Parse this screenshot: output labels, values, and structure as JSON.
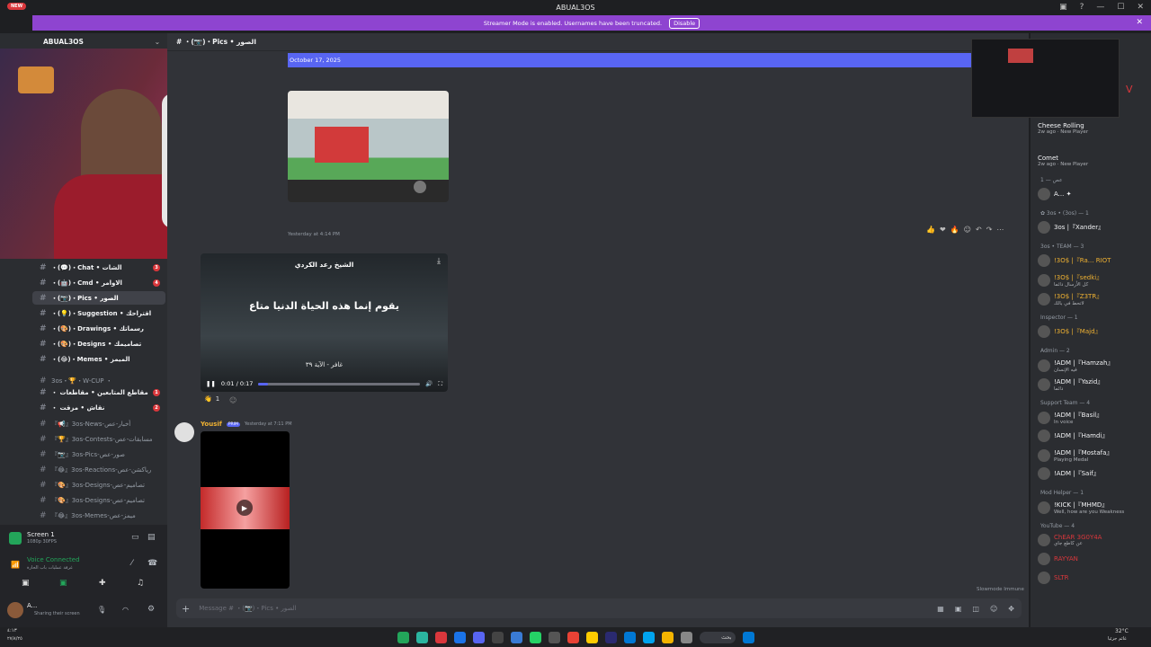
{
  "window": {
    "title": "ABUAL3OS",
    "new_badge": "NEW"
  },
  "banner": {
    "text": "Streamer Mode is enabled. Usernames have been truncated.",
    "button": "Disable"
  },
  "server": {
    "name": "ABUAL3OS"
  },
  "channel_header": {
    "name": "# ・(📷)・Pics • الصور"
  },
  "channels": [
    {
      "label": "・(💬)・Chat • الشات",
      "badge": "3",
      "white": true
    },
    {
      "label": "・(🤖)・Cmd • الاوامر",
      "badge": "4",
      "white": true
    },
    {
      "label": "・(📷)・Pics • الصور",
      "badge": "",
      "white": true,
      "selected": true
    },
    {
      "label": "・(💡)・Suggestion • اقتراحك",
      "badge": "",
      "white": true
    },
    {
      "label": "・(🎨)・Drawings • رسماتك",
      "badge": "",
      "white": true
    },
    {
      "label": "・(🎨)・Designs • تصاميمك",
      "badge": "",
      "white": true
    },
    {
      "label": "・(😂)・Memes • الميمز",
      "badge": "",
      "white": true
    },
    {
      "label": "3os・🏆・W-CUP ・",
      "badge": "",
      "white": false
    },
    {
      "label": "・ مقاطع المتابعين • مقاطعات",
      "badge": "1",
      "white": true
    },
    {
      "label": "・ نقاش • مزقت",
      "badge": "2",
      "white": true
    },
    {
      "label": "『📢』3os-News-أخبار-عص",
      "badge": "",
      "white": false
    },
    {
      "label": "『🏆』3os-Contests-مسابقات-عص",
      "badge": "",
      "white": false
    },
    {
      "label": "『📷』3os-Pics-صور-عص",
      "badge": "",
      "white": false
    },
    {
      "label": "『😂』3os-Reactions-رياكشن-عص",
      "badge": "",
      "white": false
    },
    {
      "label": "『🎨』3os-Designs-تصاميم-عص",
      "badge": "",
      "white": false
    },
    {
      "label": "『🎨』3os-Designs-تصاميم-عص",
      "badge": "",
      "white": false
    },
    {
      "label": "『😂』3os-Memes-ميمز-عص",
      "badge": "",
      "white": false
    }
  ],
  "voice": {
    "screen_label": "Screen 1",
    "screen_sub": "1080p 30FPS",
    "connected": "Voice Connected",
    "connected_sub": "غرفة عمليات باب الحارة",
    "user": "A...",
    "user_status": "Sharing their screen"
  },
  "chat": {
    "date": "October 17, 2025",
    "timestamp1": "Yesterday at 4:14 PM",
    "video_title": "الشيخ رعد الكردي",
    "video_text": "يقوم إنما هذه الحياة الدنيا متاع",
    "video_caption": "غافر - الآية ٣٩",
    "video_time": "0:01 / 0:17",
    "video_progress": 0.06,
    "reaction_count": "1",
    "msg2_author": "Yousif",
    "msg2_tag": "PRIM",
    "msg2_time": "Yesterday at 7:11 PM",
    "input_placeholder": "Message # ・(📷)・Pics • الصور",
    "slowmode": "Slowmode Immune"
  },
  "members": {
    "activities": [
      {
        "name": "Cheese Rolling",
        "sub": "2w ago · New Player"
      },
      {
        "name": "Comet",
        "sub": "2w ago · New Player"
      }
    ],
    "groups": [
      {
        "label": "عص — 1",
        "users": [
          {
            "name": "A... ✦",
            "status": ""
          }
        ]
      },
      {
        "label": "✿ 3os • (3os) — 1",
        "users": [
          {
            "name": "3os |『Xander』",
            "status": ""
          }
        ]
      },
      {
        "label": "3os • TEAM — 3",
        "users": [
          {
            "name": "!3O$ |『Ra... RIOT",
            "status": ""
          },
          {
            "name": "!3O$ |『sedki』",
            "status": "كل الأرسال دائما"
          },
          {
            "name": "!3O$ |『Z3TR』",
            "status": "لاتحط في بالك"
          }
        ]
      },
      {
        "label": "Inspector — 1",
        "users": [
          {
            "name": "!3O$ |『Majd』",
            "status": ""
          }
        ]
      },
      {
        "label": "Admin — 2",
        "users": [
          {
            "name": "!ADM |『Hamzah』",
            "status": "فيه الإنسان"
          },
          {
            "name": "!ADM |『Yazid』",
            "status": "دائما"
          }
        ]
      },
      {
        "label": "Support Team — 4",
        "users": [
          {
            "name": "!ADM |『Basil』",
            "status": "In voice"
          },
          {
            "name": "!ADM |『Hamdi』",
            "status": ""
          },
          {
            "name": "!ADM |『Mostafa』",
            "status": "Playing Medal"
          },
          {
            "name": "!ADM |『Saif』",
            "status": ""
          }
        ]
      },
      {
        "label": "Mod Helper — 1",
        "users": [
          {
            "name": "!KICK |『MHMD』",
            "status": "Well, how are you Weakness"
          }
        ]
      },
      {
        "label": "YouTube — 4",
        "users": [
          {
            "name": "ChEAR 3G0Y4A",
            "status": "عن كاطع جاي"
          },
          {
            "name": "RAYYAN",
            "status": ""
          },
          {
            "name": "SLTR",
            "status": ""
          }
        ]
      }
    ]
  },
  "taskbar": {
    "search": "بحث",
    "weather": "32°C",
    "weather_sub": "غائم جزئيا",
    "clock": "٤:١٣",
    "date": "٢٧/٨/٢٥"
  },
  "colors": {
    "accent": "#5865f2",
    "banner": "#8e44d0",
    "badge": "#da373c",
    "sidebar": "#2b2d31",
    "main": "#313338"
  }
}
